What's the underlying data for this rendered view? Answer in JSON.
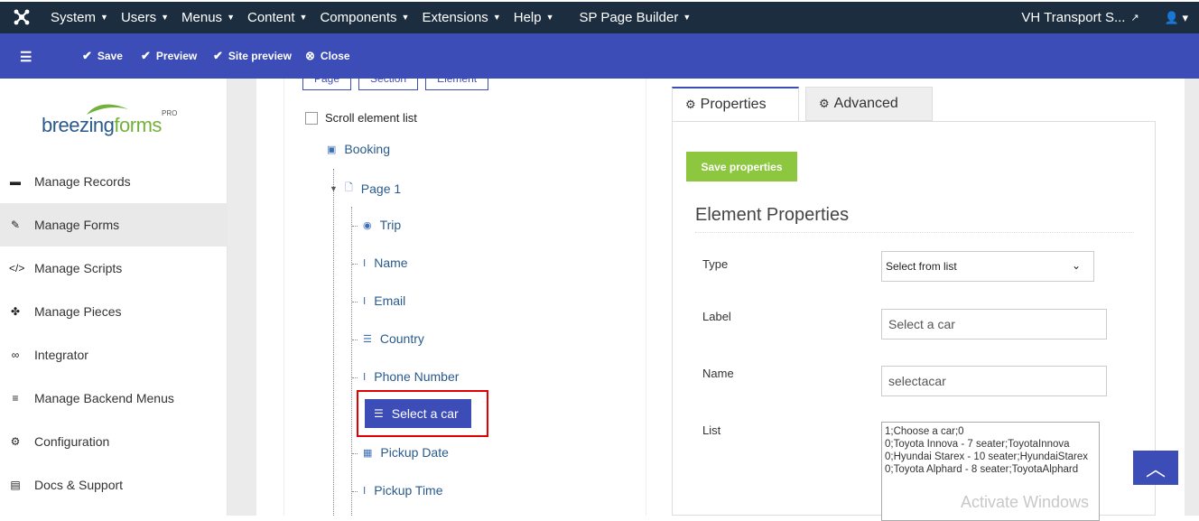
{
  "topbar": {
    "menu": [
      {
        "label": "System"
      },
      {
        "label": "Users"
      },
      {
        "label": "Menus"
      },
      {
        "label": "Content"
      },
      {
        "label": "Components"
      },
      {
        "label": "Extensions"
      },
      {
        "label": "Help"
      },
      {
        "label": "SP Page Builder"
      }
    ],
    "site_link": "VH Transport S...",
    "user_icon": "user-icon"
  },
  "toolbar": {
    "save": "Save",
    "preview": "Preview",
    "site_preview": "Site preview",
    "close": "Close"
  },
  "sidebar": {
    "logo_main": "breezing",
    "logo_sub": "forms",
    "logo_pro": "PRO",
    "items": [
      {
        "label": "Manage Records",
        "icon": "folder-open-icon"
      },
      {
        "label": "Manage Forms",
        "icon": "edit-icon"
      },
      {
        "label": "Manage Scripts",
        "icon": "code-icon"
      },
      {
        "label": "Manage Pieces",
        "icon": "puzzle-icon"
      },
      {
        "label": "Integrator",
        "icon": "link-icon"
      },
      {
        "label": "Manage Backend Menus",
        "icon": "bars-icon"
      },
      {
        "label": "Configuration",
        "icon": "gear-icon"
      },
      {
        "label": "Docs & Support",
        "icon": "document-icon"
      }
    ]
  },
  "tree": {
    "top_buttons": [
      "Page",
      "Section",
      "Element"
    ],
    "scroll_checkbox": "Scroll element list",
    "root": "Booking",
    "page": "Page 1",
    "elements": [
      {
        "label": "Trip",
        "icon": "radio-icon"
      },
      {
        "label": "Name",
        "icon": "textfield-icon"
      },
      {
        "label": "Email",
        "icon": "textfield-icon"
      },
      {
        "label": "Country",
        "icon": "select-icon"
      },
      {
        "label": "Phone Number",
        "icon": "textfield-icon"
      },
      {
        "label": "Select a car",
        "icon": "select-icon"
      },
      {
        "label": "Pickup Date",
        "icon": "calendar-icon"
      },
      {
        "label": "Pickup Time",
        "icon": "textfield-icon"
      }
    ]
  },
  "properties": {
    "tab_properties": "Properties",
    "tab_advanced": "Advanced",
    "save_button": "Save properties",
    "title": "Element Properties",
    "type_label": "Type",
    "type_value": "Select from list",
    "label_label": "Label",
    "label_value": "Select a car",
    "name_label": "Name",
    "name_value": "selectacar",
    "list_label": "List",
    "list_value": "1;Choose a car;0\n0;Toyota Innova - 7 seater;ToyotaInnova\n0;Hyundai Starex - 10 seater;HyundaiStarex\n0;Toyota Alphard - 8 seater;ToyotaAlphard"
  },
  "watermark": "Activate Windows",
  "colors": {
    "topbar": "#1c2d3f",
    "toolbar": "#3d4db7",
    "accent": "#8dc63f",
    "highlight": "#e00000"
  }
}
